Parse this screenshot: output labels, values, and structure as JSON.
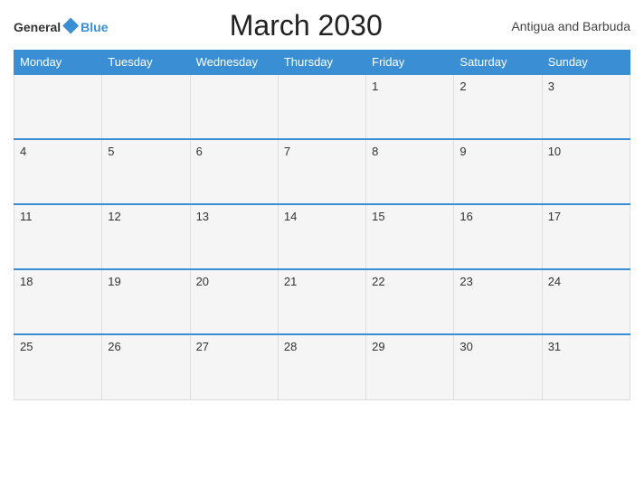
{
  "header": {
    "logo_general": "General",
    "logo_blue": "Blue",
    "title": "March 2030",
    "country": "Antigua and Barbuda"
  },
  "calendar": {
    "days_of_week": [
      "Monday",
      "Tuesday",
      "Wednesday",
      "Thursday",
      "Friday",
      "Saturday",
      "Sunday"
    ],
    "weeks": [
      [
        "",
        "",
        "",
        "1",
        "2",
        "3"
      ],
      [
        "4",
        "5",
        "6",
        "7",
        "8",
        "9",
        "10"
      ],
      [
        "11",
        "12",
        "13",
        "14",
        "15",
        "16",
        "17"
      ],
      [
        "18",
        "19",
        "20",
        "21",
        "22",
        "23",
        "24"
      ],
      [
        "25",
        "26",
        "27",
        "28",
        "29",
        "30",
        "31"
      ]
    ]
  }
}
